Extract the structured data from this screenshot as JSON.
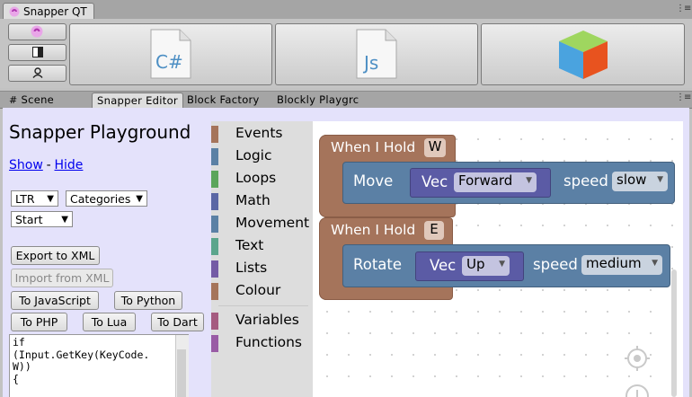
{
  "window": {
    "tab_title": "Snapper QT",
    "menu_glyph": "⋮≡"
  },
  "toolbar": {
    "small_buttons": [
      {
        "name": "snapper-logo-icon"
      },
      {
        "name": "layout-toggle-icon"
      },
      {
        "name": "user-icon"
      }
    ],
    "big_buttons": [
      {
        "name": "csharp-file-icon",
        "label": "C#"
      },
      {
        "name": "javascript-file-icon",
        "label": "Js"
      },
      {
        "name": "unity-cube-icon",
        "label": ""
      }
    ]
  },
  "tabs": [
    {
      "label": "Scene",
      "icon": "grid-icon"
    },
    {
      "label": "Snapper Editor",
      "active": true
    },
    {
      "label": "Block Factory"
    },
    {
      "label": "Blockly Playgrc"
    }
  ],
  "playground": {
    "title": "Snapper Playground",
    "show_label": "Show",
    "separator": "-",
    "hide_label": "Hide",
    "direction_select": "LTR",
    "toolbox_select": "Categories",
    "position_select": "Start",
    "buttons": {
      "export_xml": "Export to XML",
      "import_xml": "Import from XML",
      "to_js": "To JavaScript",
      "to_python": "To Python",
      "to_php": "To PHP",
      "to_lua": "To Lua",
      "to_dart": "To Dart"
    },
    "code_output": "if\n(Input.GetKey(KeyCode.\nW))\n{"
  },
  "blockly": {
    "categories": [
      {
        "label": "Events",
        "color": "#a5745b"
      },
      {
        "label": "Logic",
        "color": "#5b80a5"
      },
      {
        "label": "Loops",
        "color": "#5ba55b"
      },
      {
        "label": "Math",
        "color": "#5b67a5"
      },
      {
        "label": "Movement",
        "color": "#5b80a5"
      },
      {
        "label": "Text",
        "color": "#5ba58c"
      },
      {
        "label": "Lists",
        "color": "#745ba5"
      },
      {
        "label": "Colour",
        "color": "#a5745b"
      }
    ],
    "extra_categories": [
      {
        "label": "Variables",
        "color": "#a55b80"
      },
      {
        "label": "Functions",
        "color": "#995ba5"
      }
    ],
    "blocks": [
      {
        "event_label": "When I Hold",
        "key": "W",
        "action": "Move",
        "vec_label": "Vec",
        "vec_value": "Forward",
        "speed_label": "speed",
        "speed_value": "slow"
      },
      {
        "event_label": "When I Hold",
        "key": "E",
        "action": "Rotate",
        "vec_label": "Vec",
        "vec_value": "Up",
        "speed_label": "speed",
        "speed_value": "medium"
      }
    ],
    "colors": {
      "event": "#a5745b",
      "motion": "#5b80a5",
      "vector": "#5b5ba5"
    }
  }
}
